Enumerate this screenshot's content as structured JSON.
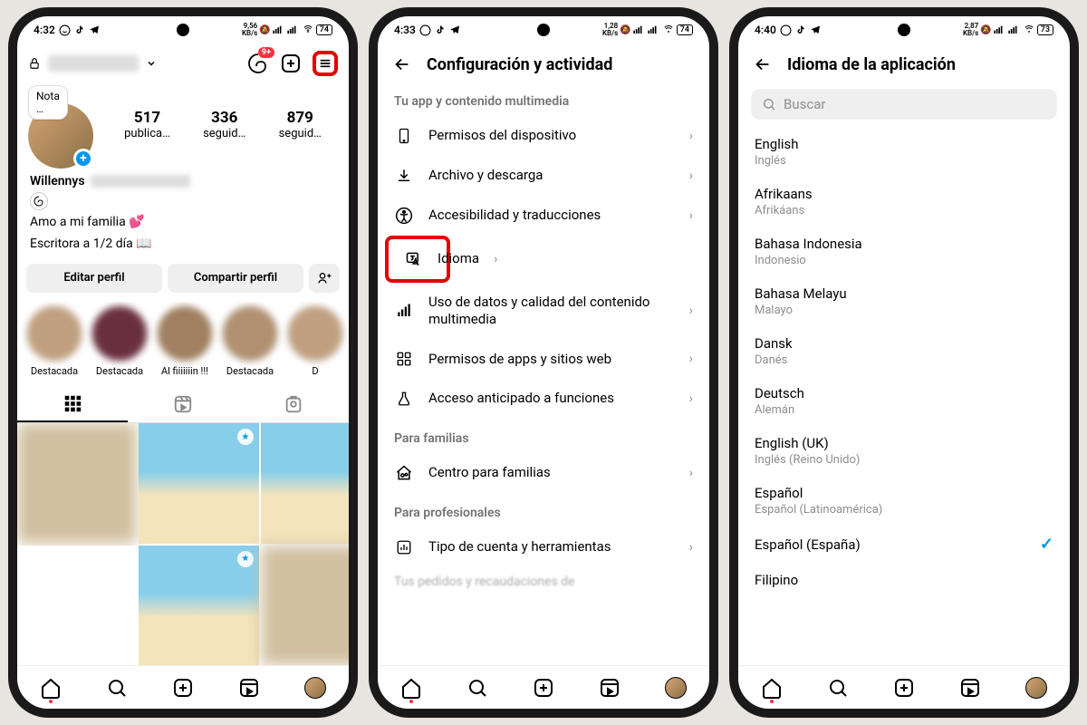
{
  "phone1": {
    "status": {
      "time": "4:32",
      "net": "9,56",
      "netUnit": "KB/s",
      "battery": "74"
    },
    "note_label": "Nota",
    "note_ellipsis": "…",
    "stats": {
      "posts": {
        "num": "517",
        "label": "publica…"
      },
      "followers": {
        "num": "336",
        "label": "seguid…"
      },
      "following": {
        "num": "879",
        "label": "seguid…"
      }
    },
    "display_name": "Willennys",
    "bio_line1": "Amo a mi familia 💕",
    "bio_line2": "Escritora a 1/2 día 📖",
    "btn_edit": "Editar perfil",
    "btn_share": "Compartir perfil",
    "highlights": [
      {
        "label": "Destacada"
      },
      {
        "label": "Destacada"
      },
      {
        "label": "Al fiiiiiiin !!!"
      },
      {
        "label": "Destacada"
      },
      {
        "label": "D"
      }
    ],
    "threads_badge": "9+"
  },
  "phone2": {
    "status": {
      "time": "4:33",
      "net": "1,28",
      "netUnit": "KB/s",
      "battery": "74"
    },
    "header": "Configuración y actividad",
    "section1": "Tu app y contenido multimedia",
    "rows1": [
      {
        "icon": "phone-icon",
        "label": "Permisos del dispositivo"
      },
      {
        "icon": "download-icon",
        "label": "Archivo y descarga"
      },
      {
        "icon": "accessibility-icon",
        "label": "Accesibilidad y traducciones"
      },
      {
        "icon": "language-icon",
        "label": "Idioma",
        "highlight": true
      },
      {
        "icon": "signal-icon",
        "label": "Uso de datos y calidad del contenido multimedia"
      },
      {
        "icon": "apps-icon",
        "label": "Permisos de apps y sitios web"
      },
      {
        "icon": "flask-icon",
        "label": "Acceso anticipado a funciones"
      }
    ],
    "section2": "Para familias",
    "rows2": [
      {
        "icon": "family-icon",
        "label": "Centro para familias"
      }
    ],
    "section3": "Para profesionales",
    "rows3": [
      {
        "icon": "chart-icon",
        "label": "Tipo de cuenta y herramientas"
      }
    ],
    "truncated": "Tus pedidos y recaudaciones de"
  },
  "phone3": {
    "status": {
      "time": "4:40",
      "net": "2,87",
      "netUnit": "KB/s",
      "battery": "73"
    },
    "header": "Idioma de la aplicación",
    "search_placeholder": "Buscar",
    "languages": [
      {
        "name": "English",
        "sub": "Inglés"
      },
      {
        "name": "Afrikaans",
        "sub": "Afrikáans"
      },
      {
        "name": "Bahasa Indonesia",
        "sub": "Indonesio"
      },
      {
        "name": "Bahasa Melayu",
        "sub": "Malayo"
      },
      {
        "name": "Dansk",
        "sub": "Danés"
      },
      {
        "name": "Deutsch",
        "sub": "Alemán"
      },
      {
        "name": "English (UK)",
        "sub": "Inglés (Reino Unido)"
      },
      {
        "name": "Español",
        "sub": "Español (Latinoamérica)"
      },
      {
        "name": "Español (España)",
        "sub": "",
        "selected": true
      },
      {
        "name": "Filipino",
        "sub": ""
      }
    ]
  }
}
